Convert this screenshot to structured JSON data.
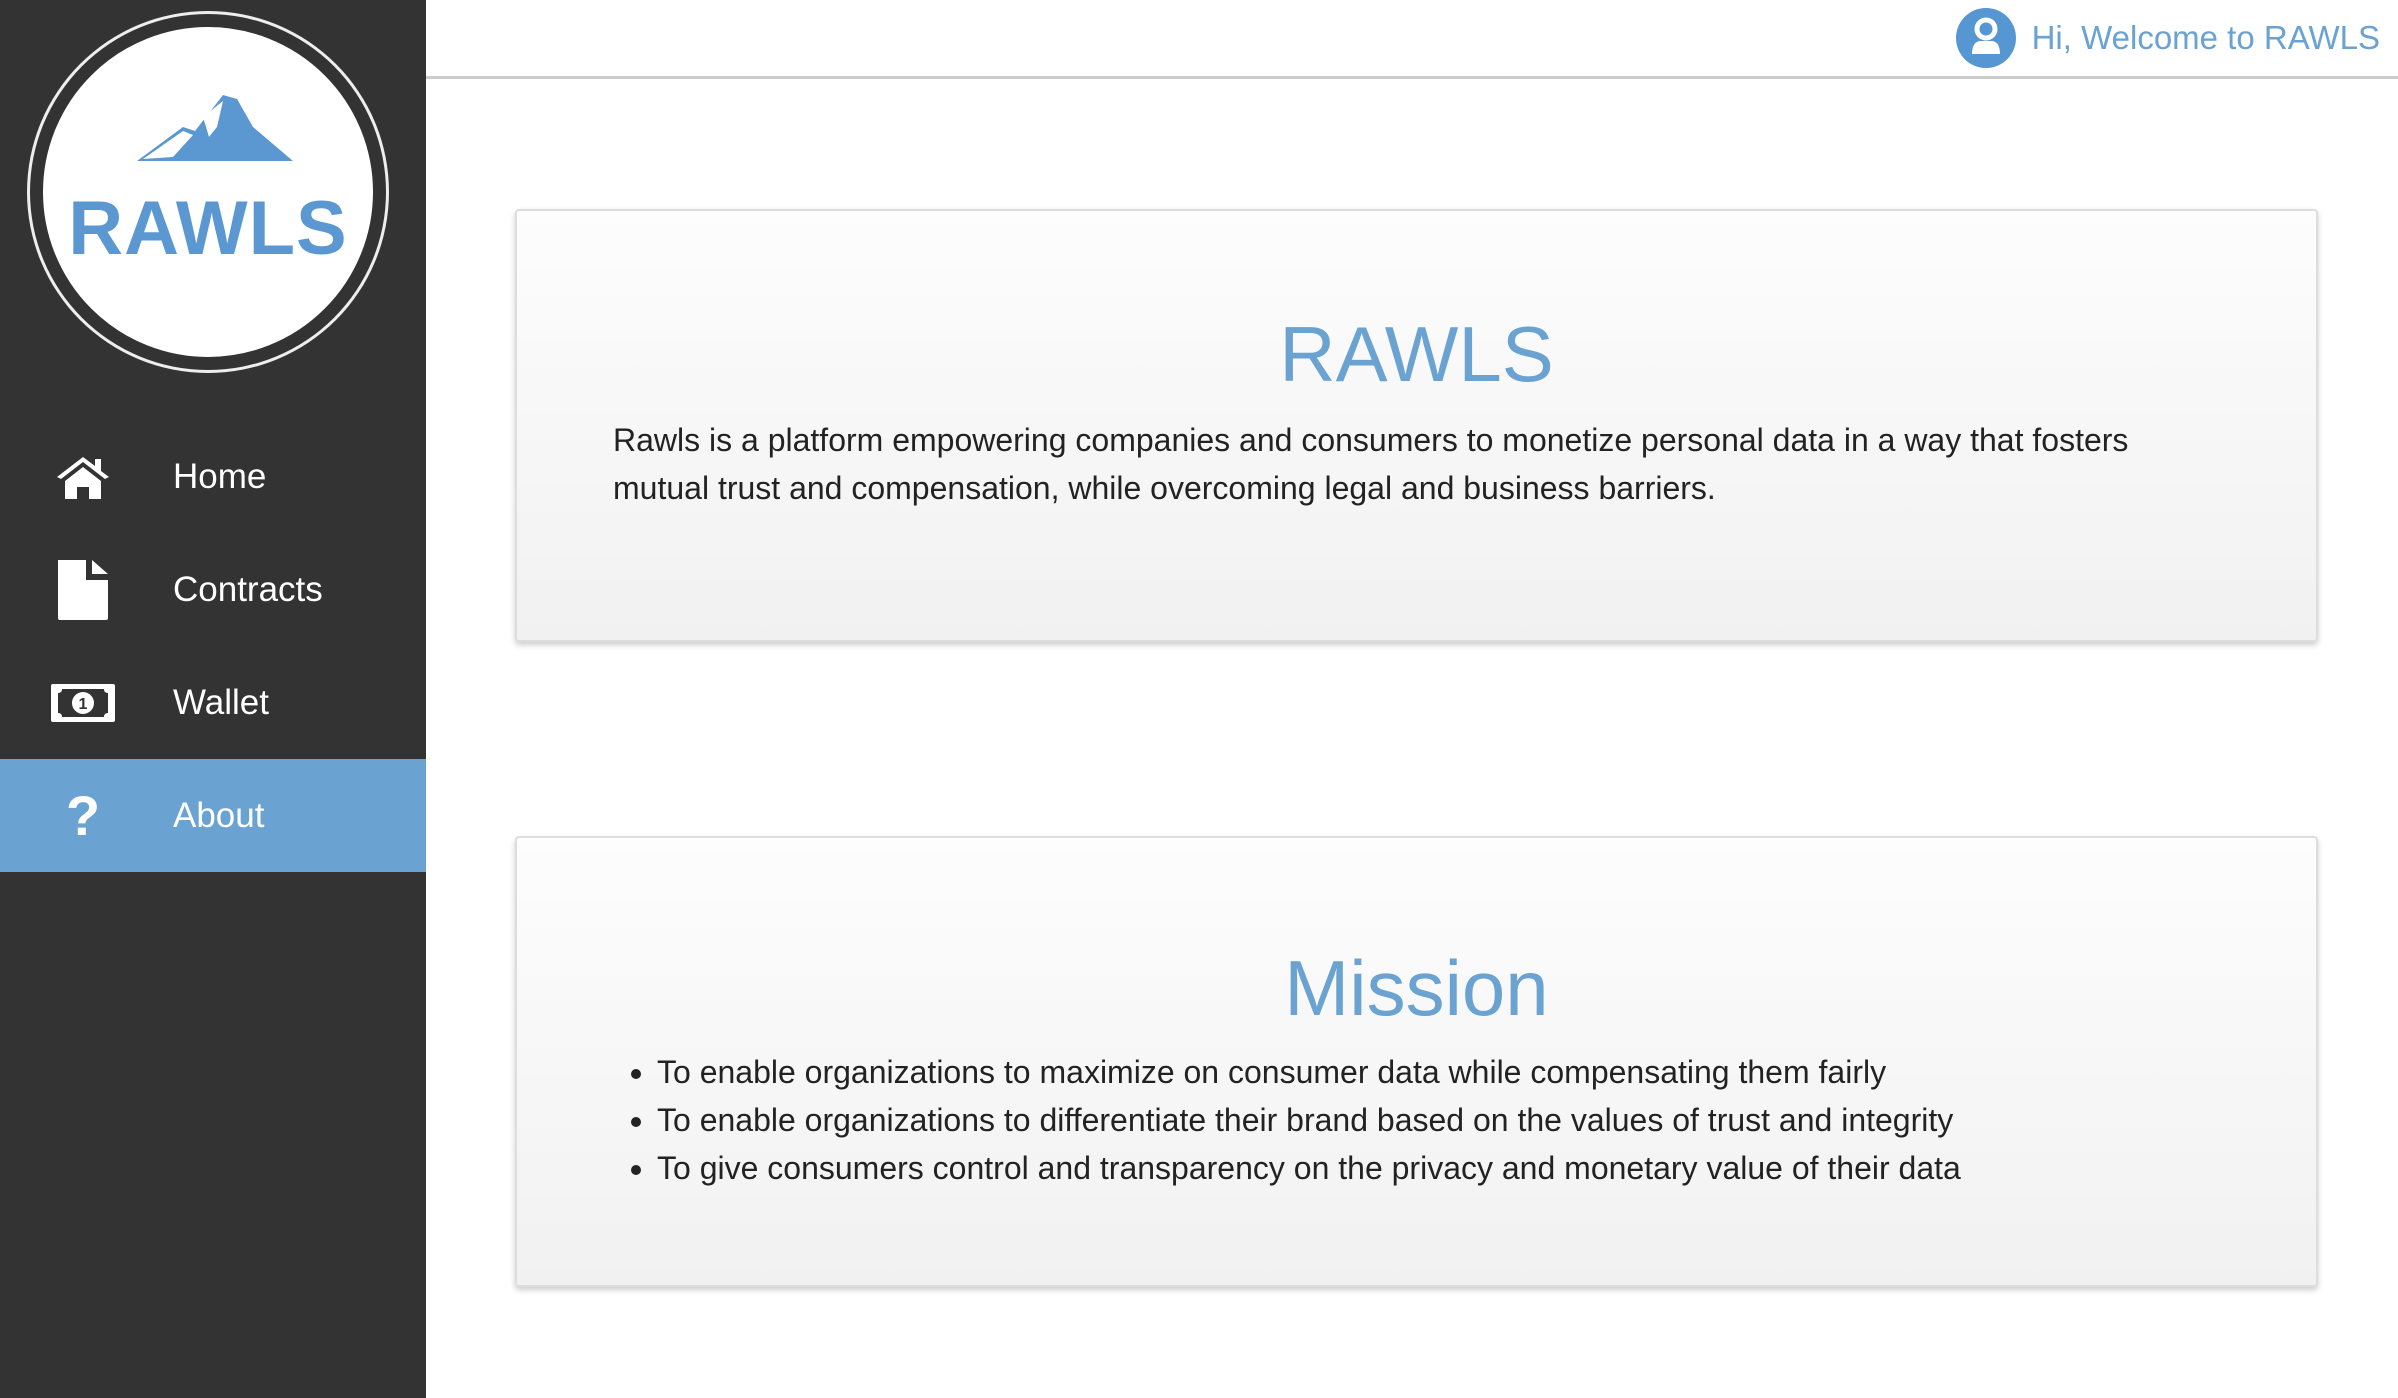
{
  "sidebar": {
    "logo_text": "RAWLS",
    "items": [
      {
        "label": "Home",
        "icon": "home-icon",
        "active": false
      },
      {
        "label": "Contracts",
        "icon": "file-icon",
        "active": false
      },
      {
        "label": "Wallet",
        "icon": "money-bill-icon",
        "active": false
      },
      {
        "label": "About",
        "icon": "question-icon",
        "active": true
      }
    ]
  },
  "header": {
    "welcome": "Hi, Welcome to RAWLS",
    "icon": "user-circle-icon"
  },
  "main": {
    "about": {
      "title": "RAWLS",
      "text": "Rawls is a platform empowering companies and consumers to monetize personal data in a way that fosters mutual trust and compensation, while overcoming legal and business barriers."
    },
    "mission": {
      "title": "Mission",
      "items": [
        "To enable organizations to maximize on consumer data while compensating them fairly",
        "To enable organizations to differentiate their brand based on the values of trust and integrity",
        "To give consumers control and transparency on the privacy and monetary value of their data"
      ]
    }
  },
  "colors": {
    "accent": "#6aa2d2",
    "sidebar": "#333333"
  }
}
